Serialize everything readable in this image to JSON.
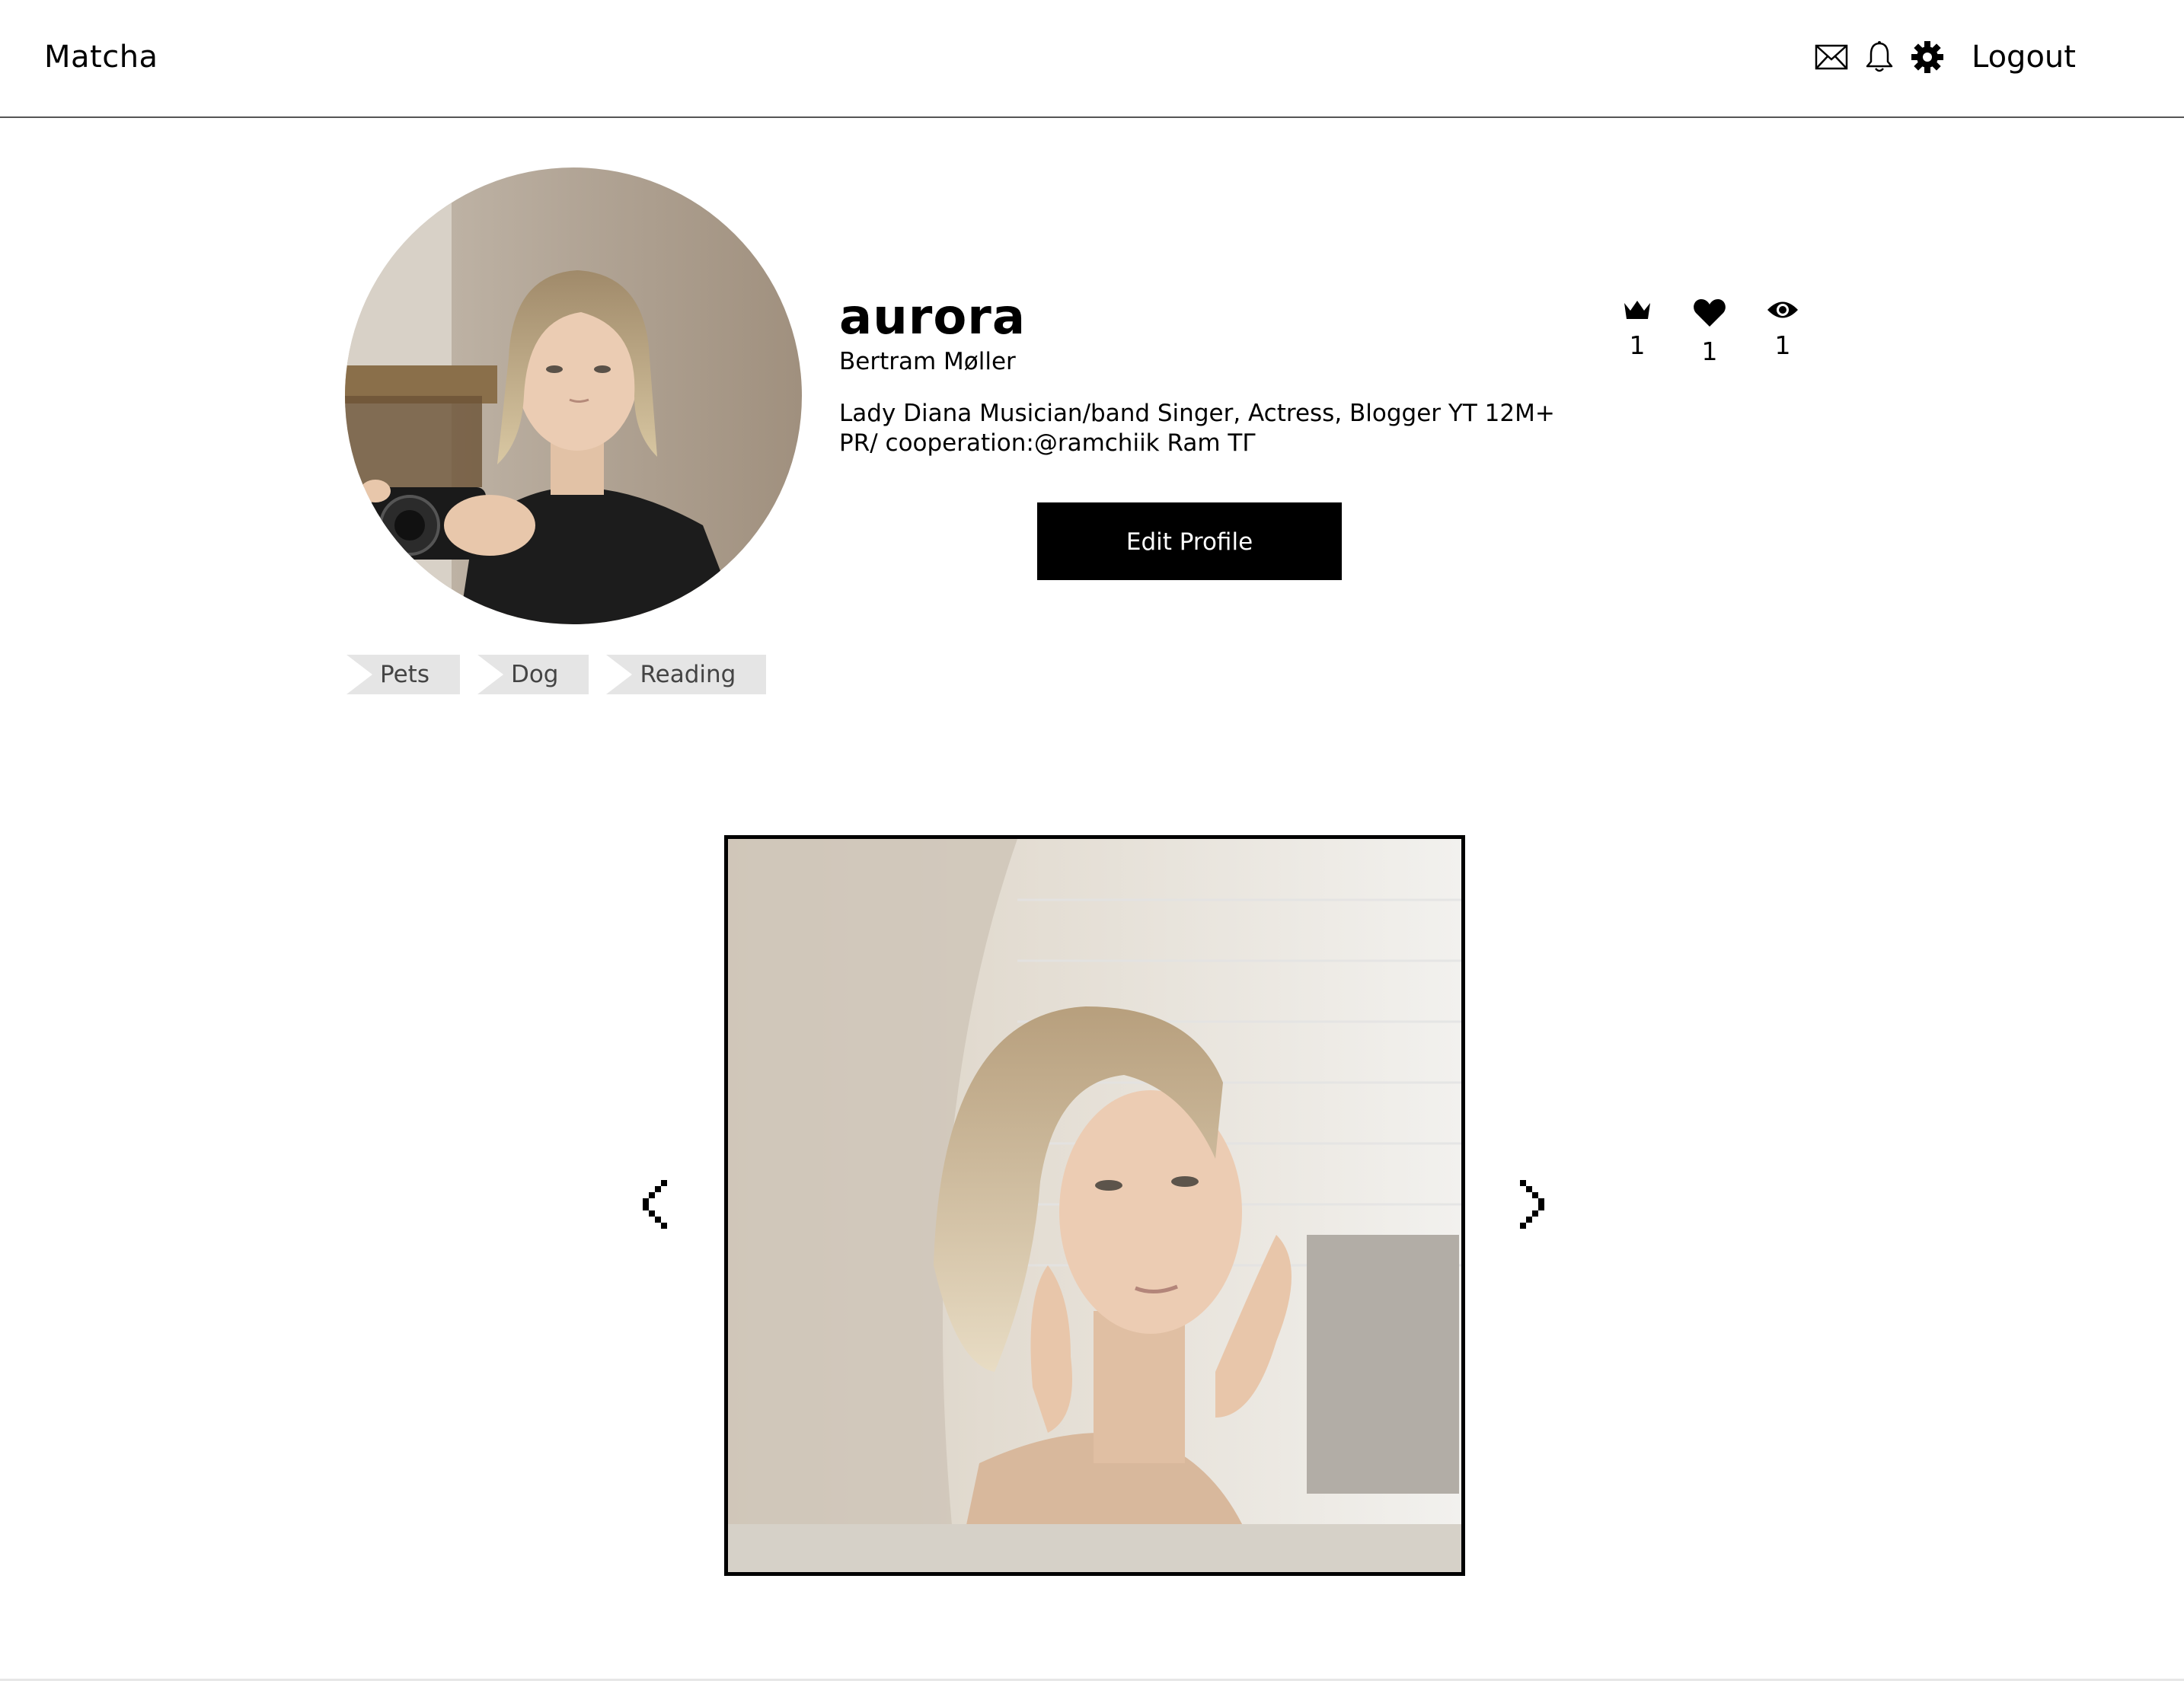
{
  "app": {
    "title": "Matcha"
  },
  "nav": {
    "icons": [
      "mail-icon",
      "bell-icon",
      "gear-icon"
    ],
    "logout_label": "Logout"
  },
  "profile": {
    "username": "aurora",
    "full_name": "Bertram Møller",
    "bio": "Lady Diana Musician/band Singer, Actress, Blogger YT 12M+ PR/ cooperation:@ramchiik Ram ТГ",
    "edit_button_label": "Edit Profile",
    "stats": [
      {
        "icon": "crown-icon",
        "value": "1"
      },
      {
        "icon": "heart-icon",
        "value": "1"
      },
      {
        "icon": "eye-icon",
        "value": "1"
      }
    ],
    "tags": [
      "Pets",
      "Dog",
      "Reading"
    ]
  },
  "gallery": {
    "prev_icon": "chevron-left-icon",
    "next_icon": "chevron-right-icon"
  },
  "colors": {
    "primary": "#000000",
    "tag_bg": "#e5e5e5",
    "tag_text": "#444444",
    "divider": "#555555"
  }
}
